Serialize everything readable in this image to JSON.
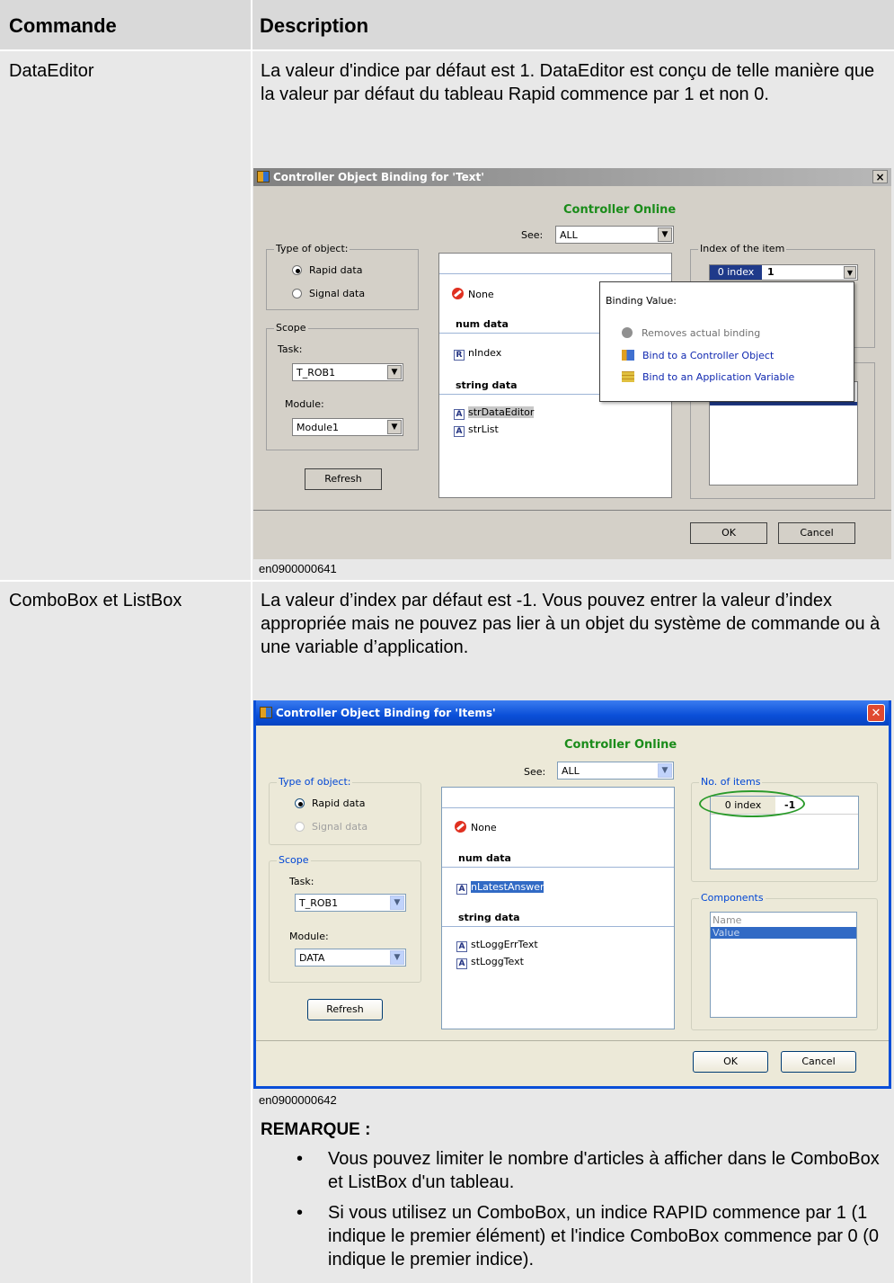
{
  "table": {
    "header": {
      "command": "Commande",
      "description": "Description"
    },
    "rows": [
      {
        "command": "DataEditor",
        "description": "La valeur d'indice par défaut est 1. DataEditor est conçu de telle manière que la valeur par défaut du tableau Rapid commence par 1 et non 0.",
        "figure_caption": "en0900000641"
      },
      {
        "command": "ComboBox et ListBox",
        "description": "La valeur d’index par défaut est -1. Vous pouvez entrer la valeur d’index appropriée mais ne pouvez pas lier à un objet du système de commande ou à une variable d’application.",
        "figure_caption": "en0900000642",
        "note_title": "REMARQUE :",
        "bullets": [
          "Vous pouvez limiter le nombre d'articles à afficher dans le ComboBox  et ListBox d'un tableau.",
          "Si vous utilisez un ComboBox, un indice RAPID commence par 1 (1 indique le premier élément) et l'indice ComboBox commence par 0 (0 indique le premier indice)."
        ]
      }
    ]
  },
  "dialog1": {
    "title": "Controller Object Binding for 'Text'",
    "close": "×",
    "status": "Controller Online",
    "see_label": "See:",
    "see_value": "ALL",
    "type_group": "Type of object:",
    "radio_rapid": "Rapid data",
    "radio_signal": "Signal data",
    "scope_group": "Scope",
    "task_label": "Task:",
    "task_value": "T_ROB1",
    "module_label": "Module:",
    "module_value": "Module1",
    "refresh": "Refresh",
    "none": "None",
    "num_data": "num data",
    "item_nindex": "nIndex",
    "string_data": "string data",
    "item_str1": "strDataEditor",
    "item_str2": "strList",
    "index_group": "Index of the item",
    "index_label": "0 index",
    "index_value": "1",
    "popup_title": "Binding Value:",
    "popup_remove": "Removes actual binding",
    "popup_bind_ctrl": "Bind to a Controller Object",
    "popup_bind_app": "Bind to an Application Variable",
    "ok": "OK",
    "cancel": "Cancel"
  },
  "dialog2": {
    "title": "Controller Object Binding for 'Items'",
    "close": "✕",
    "status": "Controller Online",
    "see_label": "See:",
    "see_value": "ALL",
    "type_group": "Type of object:",
    "radio_rapid": "Rapid data",
    "radio_signal": "Signal data",
    "scope_group": "Scope",
    "task_label": "Task:",
    "task_value": "T_ROB1",
    "module_label": "Module:",
    "module_value": "DATA",
    "refresh": "Refresh",
    "none": "None",
    "num_data": "num data",
    "item_num": "nLatestAnswer",
    "string_data": "string data",
    "item_str1": "stLoggErrText",
    "item_str2": "stLoggText",
    "items_group": "No. of items",
    "index_label": "0 index",
    "index_value": "-1",
    "components_group": "Components",
    "comp_name": "Name",
    "comp_value": "Value",
    "ok": "OK",
    "cancel": "Cancel"
  },
  "colors": {
    "header_bg": "#d9d9d9",
    "cell_bg": "#e8e8e8",
    "dialog_bg": "#d4d0c8",
    "titlebar_classic": "#808080",
    "titlebar_xp": "#0a4fd8",
    "status_green": "#1a8c1a",
    "ellipse_green": "#2a9a2a"
  }
}
